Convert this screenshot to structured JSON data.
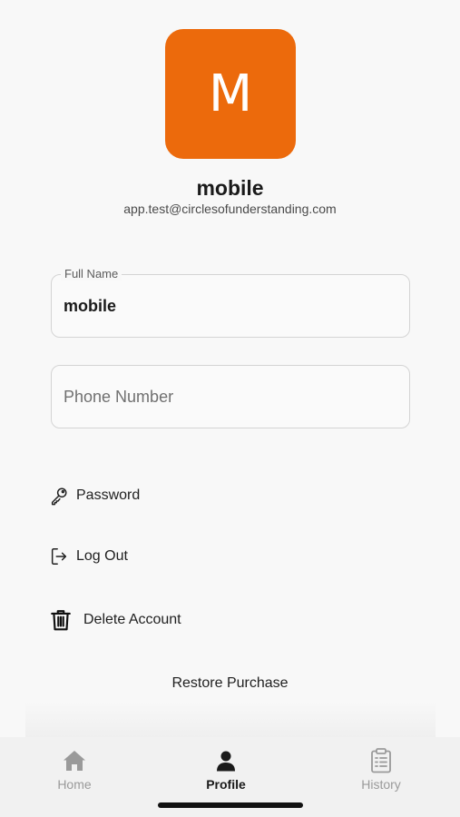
{
  "profile": {
    "avatar_letter": "M",
    "name": "mobile",
    "email": "app.test@circlesofunderstanding.com"
  },
  "form": {
    "full_name_label": "Full Name",
    "full_name_value": "mobile",
    "phone_placeholder": "Phone Number",
    "phone_value": ""
  },
  "menu": {
    "password": "Password",
    "log_out": "Log Out",
    "delete_account": "Delete Account",
    "restore_purchase": "Restore Purchase"
  },
  "tabs": [
    {
      "label": "Home",
      "icon": "home-icon",
      "active": false
    },
    {
      "label": "Profile",
      "icon": "person-icon",
      "active": true
    },
    {
      "label": "History",
      "icon": "clipboard-icon",
      "active": false
    }
  ],
  "colors": {
    "avatar_bg": "#ec6a0c",
    "background": "#f8f8f8",
    "tab_active": "#1a1a1a",
    "tab_inactive": "#9a9a9a"
  }
}
